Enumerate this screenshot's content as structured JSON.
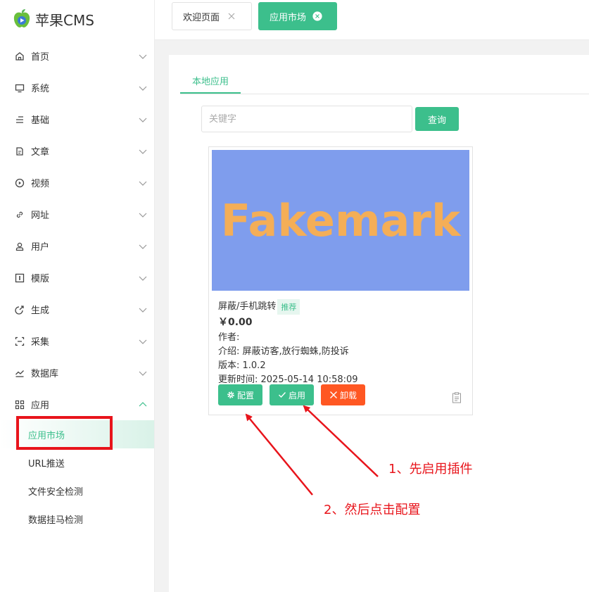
{
  "app": {
    "logo_text": "苹果CMS"
  },
  "sidebar": {
    "items": [
      {
        "label": "首页",
        "icon": "home-icon"
      },
      {
        "label": "系统",
        "icon": "monitor-icon"
      },
      {
        "label": "基础",
        "icon": "list-icon"
      },
      {
        "label": "文章",
        "icon": "article-icon"
      },
      {
        "label": "视频",
        "icon": "play-icon"
      },
      {
        "label": "网址",
        "icon": "link-icon"
      },
      {
        "label": "用户",
        "icon": "user-icon"
      },
      {
        "label": "模版",
        "icon": "template-icon"
      },
      {
        "label": "生成",
        "icon": "generate-icon"
      },
      {
        "label": "采集",
        "icon": "collect-icon"
      },
      {
        "label": "数据库",
        "icon": "chart-line-icon"
      },
      {
        "label": "应用",
        "icon": "apps-grid-icon",
        "expanded": true
      }
    ],
    "subitems": [
      {
        "label": "应用市场",
        "active": true
      },
      {
        "label": "URL推送"
      },
      {
        "label": "文件安全检测"
      },
      {
        "label": "数据挂马检测"
      }
    ]
  },
  "tabs": [
    {
      "label": "欢迎页面",
      "active": false
    },
    {
      "label": "应用市场",
      "active": true
    }
  ],
  "main": {
    "tab_label": "本地应用",
    "search": {
      "placeholder": "关键字",
      "value": ""
    },
    "search_button": "查询"
  },
  "plugin_card": {
    "image_text": "Fakemark",
    "name": "屏蔽/手机跳转",
    "tag": "推荐",
    "price": "￥0.00",
    "author": "作者:",
    "intro": "介绍: 屏蔽访客,放行蜘蛛,防投诉",
    "version": "版本: 1.0.2",
    "updated": "更新时间: 2025-05-14 10:58:09",
    "buttons": {
      "config": "配置",
      "enable": "启用",
      "uninstall": "卸载"
    }
  },
  "annotations": {
    "step1": "1、先启用插件",
    "step2": "2、然后点击配置"
  },
  "colors": {
    "accent": "#3cbf8c",
    "danger": "#ff5722",
    "annotation": "#e8141b",
    "image_bg": "#7f9ded",
    "image_text": "#f4ae57"
  }
}
